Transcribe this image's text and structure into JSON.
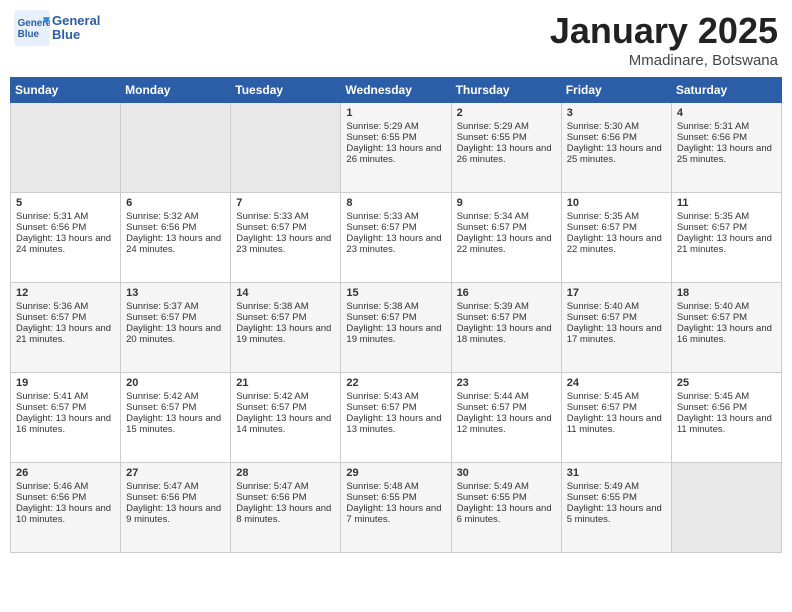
{
  "header": {
    "logo_text_general": "General",
    "logo_text_blue": "Blue",
    "title": "January 2025",
    "location": "Mmadinare, Botswana"
  },
  "weekdays": [
    "Sunday",
    "Monday",
    "Tuesday",
    "Wednesday",
    "Thursday",
    "Friday",
    "Saturday"
  ],
  "weeks": [
    [
      {
        "day": "",
        "sunrise": "",
        "sunset": "",
        "daylight": ""
      },
      {
        "day": "",
        "sunrise": "",
        "sunset": "",
        "daylight": ""
      },
      {
        "day": "",
        "sunrise": "",
        "sunset": "",
        "daylight": ""
      },
      {
        "day": "1",
        "sunrise": "Sunrise: 5:29 AM",
        "sunset": "Sunset: 6:55 PM",
        "daylight": "Daylight: 13 hours and 26 minutes."
      },
      {
        "day": "2",
        "sunrise": "Sunrise: 5:29 AM",
        "sunset": "Sunset: 6:55 PM",
        "daylight": "Daylight: 13 hours and 26 minutes."
      },
      {
        "day": "3",
        "sunrise": "Sunrise: 5:30 AM",
        "sunset": "Sunset: 6:56 PM",
        "daylight": "Daylight: 13 hours and 25 minutes."
      },
      {
        "day": "4",
        "sunrise": "Sunrise: 5:31 AM",
        "sunset": "Sunset: 6:56 PM",
        "daylight": "Daylight: 13 hours and 25 minutes."
      }
    ],
    [
      {
        "day": "5",
        "sunrise": "Sunrise: 5:31 AM",
        "sunset": "Sunset: 6:56 PM",
        "daylight": "Daylight: 13 hours and 24 minutes."
      },
      {
        "day": "6",
        "sunrise": "Sunrise: 5:32 AM",
        "sunset": "Sunset: 6:56 PM",
        "daylight": "Daylight: 13 hours and 24 minutes."
      },
      {
        "day": "7",
        "sunrise": "Sunrise: 5:33 AM",
        "sunset": "Sunset: 6:57 PM",
        "daylight": "Daylight: 13 hours and 23 minutes."
      },
      {
        "day": "8",
        "sunrise": "Sunrise: 5:33 AM",
        "sunset": "Sunset: 6:57 PM",
        "daylight": "Daylight: 13 hours and 23 minutes."
      },
      {
        "day": "9",
        "sunrise": "Sunrise: 5:34 AM",
        "sunset": "Sunset: 6:57 PM",
        "daylight": "Daylight: 13 hours and 22 minutes."
      },
      {
        "day": "10",
        "sunrise": "Sunrise: 5:35 AM",
        "sunset": "Sunset: 6:57 PM",
        "daylight": "Daylight: 13 hours and 22 minutes."
      },
      {
        "day": "11",
        "sunrise": "Sunrise: 5:35 AM",
        "sunset": "Sunset: 6:57 PM",
        "daylight": "Daylight: 13 hours and 21 minutes."
      }
    ],
    [
      {
        "day": "12",
        "sunrise": "Sunrise: 5:36 AM",
        "sunset": "Sunset: 6:57 PM",
        "daylight": "Daylight: 13 hours and 21 minutes."
      },
      {
        "day": "13",
        "sunrise": "Sunrise: 5:37 AM",
        "sunset": "Sunset: 6:57 PM",
        "daylight": "Daylight: 13 hours and 20 minutes."
      },
      {
        "day": "14",
        "sunrise": "Sunrise: 5:38 AM",
        "sunset": "Sunset: 6:57 PM",
        "daylight": "Daylight: 13 hours and 19 minutes."
      },
      {
        "day": "15",
        "sunrise": "Sunrise: 5:38 AM",
        "sunset": "Sunset: 6:57 PM",
        "daylight": "Daylight: 13 hours and 19 minutes."
      },
      {
        "day": "16",
        "sunrise": "Sunrise: 5:39 AM",
        "sunset": "Sunset: 6:57 PM",
        "daylight": "Daylight: 13 hours and 18 minutes."
      },
      {
        "day": "17",
        "sunrise": "Sunrise: 5:40 AM",
        "sunset": "Sunset: 6:57 PM",
        "daylight": "Daylight: 13 hours and 17 minutes."
      },
      {
        "day": "18",
        "sunrise": "Sunrise: 5:40 AM",
        "sunset": "Sunset: 6:57 PM",
        "daylight": "Daylight: 13 hours and 16 minutes."
      }
    ],
    [
      {
        "day": "19",
        "sunrise": "Sunrise: 5:41 AM",
        "sunset": "Sunset: 6:57 PM",
        "daylight": "Daylight: 13 hours and 16 minutes."
      },
      {
        "day": "20",
        "sunrise": "Sunrise: 5:42 AM",
        "sunset": "Sunset: 6:57 PM",
        "daylight": "Daylight: 13 hours and 15 minutes."
      },
      {
        "day": "21",
        "sunrise": "Sunrise: 5:42 AM",
        "sunset": "Sunset: 6:57 PM",
        "daylight": "Daylight: 13 hours and 14 minutes."
      },
      {
        "day": "22",
        "sunrise": "Sunrise: 5:43 AM",
        "sunset": "Sunset: 6:57 PM",
        "daylight": "Daylight: 13 hours and 13 minutes."
      },
      {
        "day": "23",
        "sunrise": "Sunrise: 5:44 AM",
        "sunset": "Sunset: 6:57 PM",
        "daylight": "Daylight: 13 hours and 12 minutes."
      },
      {
        "day": "24",
        "sunrise": "Sunrise: 5:45 AM",
        "sunset": "Sunset: 6:57 PM",
        "daylight": "Daylight: 13 hours and 11 minutes."
      },
      {
        "day": "25",
        "sunrise": "Sunrise: 5:45 AM",
        "sunset": "Sunset: 6:56 PM",
        "daylight": "Daylight: 13 hours and 11 minutes."
      }
    ],
    [
      {
        "day": "26",
        "sunrise": "Sunrise: 5:46 AM",
        "sunset": "Sunset: 6:56 PM",
        "daylight": "Daylight: 13 hours and 10 minutes."
      },
      {
        "day": "27",
        "sunrise": "Sunrise: 5:47 AM",
        "sunset": "Sunset: 6:56 PM",
        "daylight": "Daylight: 13 hours and 9 minutes."
      },
      {
        "day": "28",
        "sunrise": "Sunrise: 5:47 AM",
        "sunset": "Sunset: 6:56 PM",
        "daylight": "Daylight: 13 hours and 8 minutes."
      },
      {
        "day": "29",
        "sunrise": "Sunrise: 5:48 AM",
        "sunset": "Sunset: 6:55 PM",
        "daylight": "Daylight: 13 hours and 7 minutes."
      },
      {
        "day": "30",
        "sunrise": "Sunrise: 5:49 AM",
        "sunset": "Sunset: 6:55 PM",
        "daylight": "Daylight: 13 hours and 6 minutes."
      },
      {
        "day": "31",
        "sunrise": "Sunrise: 5:49 AM",
        "sunset": "Sunset: 6:55 PM",
        "daylight": "Daylight: 13 hours and 5 minutes."
      },
      {
        "day": "",
        "sunrise": "",
        "sunset": "",
        "daylight": ""
      }
    ]
  ]
}
